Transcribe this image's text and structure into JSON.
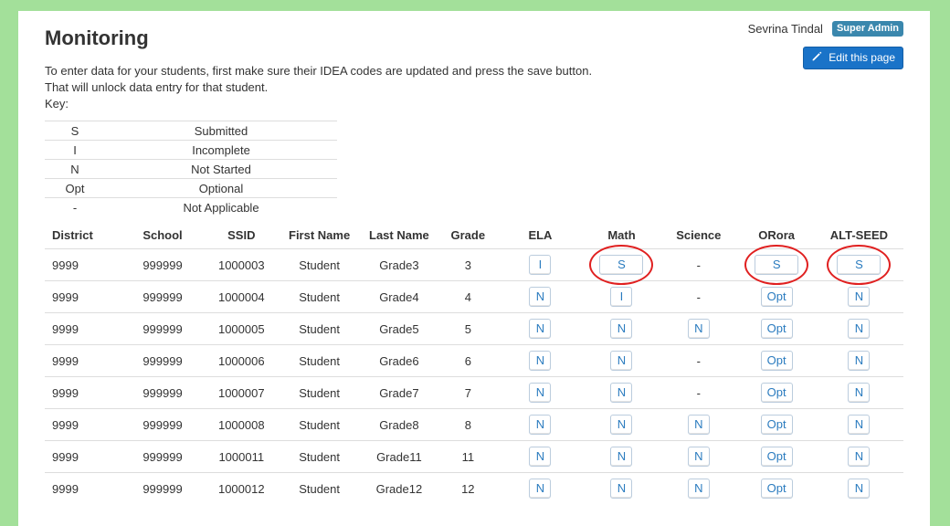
{
  "page": {
    "title": "Monitoring",
    "intro_line1": "To enter data for your students, first make sure their IDEA codes are updated and press the save button.",
    "intro_line2": "That will unlock data entry for that student.",
    "key_label": "Key:"
  },
  "user": {
    "name": "Sevrina Tindal",
    "role_badge": "Super Admin",
    "edit_label": "Edit this page",
    "edit_icon": "pencil-icon"
  },
  "colors": {
    "background": "#a3e09a",
    "accent": "#1a73c8",
    "badge": "#3a87ad",
    "highlight_ring": "#e02020"
  },
  "key": [
    {
      "code": "S",
      "meaning": "Submitted"
    },
    {
      "code": "I",
      "meaning": "Incomplete"
    },
    {
      "code": "N",
      "meaning": "Not Started"
    },
    {
      "code": "Opt",
      "meaning": "Optional"
    },
    {
      "code": "-",
      "meaning": "Not Applicable"
    }
  ],
  "table": {
    "headers": [
      "District",
      "School",
      "SSID",
      "First Name",
      "Last Name",
      "Grade",
      "ELA",
      "Math",
      "Science",
      "ORora",
      "ALT-SEED"
    ],
    "rows": [
      {
        "district": "9999",
        "school": "999999",
        "ssid": "1000003",
        "first": "Student",
        "last": "Grade3",
        "grade": "3",
        "ela": "I",
        "math": "S",
        "science": "-",
        "orora": "S",
        "alt": "S"
      },
      {
        "district": "9999",
        "school": "999999",
        "ssid": "1000004",
        "first": "Student",
        "last": "Grade4",
        "grade": "4",
        "ela": "N",
        "math": "I",
        "science": "-",
        "orora": "Opt",
        "alt": "N"
      },
      {
        "district": "9999",
        "school": "999999",
        "ssid": "1000005",
        "first": "Student",
        "last": "Grade5",
        "grade": "5",
        "ela": "N",
        "math": "N",
        "science": "N",
        "orora": "Opt",
        "alt": "N"
      },
      {
        "district": "9999",
        "school": "999999",
        "ssid": "1000006",
        "first": "Student",
        "last": "Grade6",
        "grade": "6",
        "ela": "N",
        "math": "N",
        "science": "-",
        "orora": "Opt",
        "alt": "N"
      },
      {
        "district": "9999",
        "school": "999999",
        "ssid": "1000007",
        "first": "Student",
        "last": "Grade7",
        "grade": "7",
        "ela": "N",
        "math": "N",
        "science": "-",
        "orora": "Opt",
        "alt": "N"
      },
      {
        "district": "9999",
        "school": "999999",
        "ssid": "1000008",
        "first": "Student",
        "last": "Grade8",
        "grade": "8",
        "ela": "N",
        "math": "N",
        "science": "N",
        "orora": "Opt",
        "alt": "N"
      },
      {
        "district": "9999",
        "school": "999999",
        "ssid": "1000011",
        "first": "Student",
        "last": "Grade11",
        "grade": "11",
        "ela": "N",
        "math": "N",
        "science": "N",
        "orora": "Opt",
        "alt": "N"
      },
      {
        "district": "9999",
        "school": "999999",
        "ssid": "1000012",
        "first": "Student",
        "last": "Grade12",
        "grade": "12",
        "ela": "N",
        "math": "N",
        "science": "N",
        "orora": "Opt",
        "alt": "N"
      }
    ]
  }
}
